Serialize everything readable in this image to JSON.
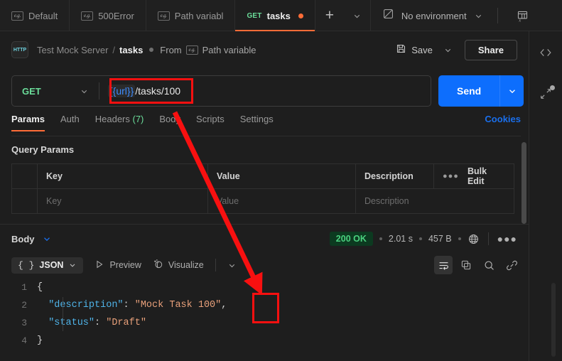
{
  "tabstrip": {
    "tabs": [
      {
        "label": "Default",
        "icon": "example-badge-icon",
        "method": "",
        "active": false,
        "unsaved": false
      },
      {
        "label": "500Error",
        "icon": "example-badge-icon",
        "method": "",
        "active": false,
        "unsaved": false
      },
      {
        "label": "Path variabl",
        "icon": "example-badge-icon",
        "method": "",
        "active": false,
        "unsaved": false
      },
      {
        "label": "tasks",
        "icon": "",
        "method": "GET",
        "active": true,
        "unsaved": true
      }
    ],
    "new_tab_label": "+",
    "tabs_caret_icon": "chevron-down-icon",
    "environment": {
      "name": "No environment",
      "caret_icon": "chevron-down-icon",
      "quicklook_icon": "environment-quicklook-icon"
    }
  },
  "rail": {
    "code_icon": "code-snippet-icon",
    "expand_icon": "expand-arrows-icon"
  },
  "breadcrumb": {
    "protocol_icon": "http-icon",
    "protocol_label": "HTTP",
    "collection": "Test Mock Server",
    "separator": "/",
    "request": "tasks",
    "from_prefix": "From",
    "from_badge_icon": "example-badge-icon",
    "from_source": "Path variable",
    "save_label": "Save",
    "save_icon": "floppy-disk-icon",
    "save_caret_icon": "chevron-down-icon",
    "share_label": "Share"
  },
  "url_bar": {
    "method": "GET",
    "method_caret_icon": "chevron-down-icon",
    "url_variable": "{{url}}",
    "url_path": " /tasks/100",
    "send_label": "Send",
    "send_caret_icon": "chevron-down-icon"
  },
  "request_tabs": {
    "items": [
      {
        "label": "Params",
        "count": "",
        "active": true
      },
      {
        "label": "Auth",
        "count": "",
        "active": false
      },
      {
        "label": "Headers",
        "count": "(7)",
        "active": false
      },
      {
        "label": "Body",
        "count": "",
        "active": false
      },
      {
        "label": "Scripts",
        "count": "",
        "active": false
      },
      {
        "label": "Settings",
        "count": "",
        "active": false
      }
    ],
    "cookies_label": "Cookies"
  },
  "query_params": {
    "section_title": "Query Params",
    "headers": [
      "",
      "Key",
      "Value",
      "Description"
    ],
    "bulk_edit_label": "Bulk Edit",
    "options_icon": "more-options-icon",
    "rows": [
      {
        "key": "Key",
        "value": "Value",
        "description": "Description"
      }
    ]
  },
  "response": {
    "body_label": "Body",
    "body_caret_icon": "chevron-down-icon",
    "status": "200 OK",
    "time": "2.01 s",
    "size": "457 B",
    "globe_icon": "globe-icon",
    "more_icon": "more-options-icon",
    "format": {
      "braces": "{ }",
      "name": "JSON",
      "caret_icon": "chevron-down-icon",
      "preview_label": "Preview",
      "preview_icon": "play-triangle-icon",
      "visualize_label": "Visualize",
      "visualize_icon": "visualize-sparkle-icon",
      "extra_caret_icon": "chevron-down-icon",
      "wrap_icon": "word-wrap-icon",
      "copy_icon": "copy-icon",
      "search_icon": "search-icon",
      "link_icon": "link-icon"
    },
    "body_lines": [
      {
        "num": "1",
        "indent": 0,
        "segments": [
          {
            "type": "brace",
            "text": "{"
          }
        ]
      },
      {
        "num": "2",
        "indent": 1,
        "segments": [
          {
            "type": "key",
            "text": "\"description\""
          },
          {
            "type": "punc",
            "text": ": "
          },
          {
            "type": "str",
            "text": "\"Mock Task 100\""
          },
          {
            "type": "punc",
            "text": ","
          }
        ]
      },
      {
        "num": "3",
        "indent": 1,
        "segments": [
          {
            "type": "key",
            "text": "\"status\""
          },
          {
            "type": "punc",
            "text": ": "
          },
          {
            "type": "str",
            "text": "\"Draft\""
          }
        ]
      },
      {
        "num": "4",
        "indent": 0,
        "segments": [
          {
            "type": "brace",
            "text": "}"
          }
        ]
      }
    ]
  },
  "annotations": {
    "color": "#f81010",
    "url_highlight_target": "{{url}} /tasks/100",
    "value_highlight_target": "100",
    "arrow_from": "url-field",
    "arrow_to": "response-100-value"
  }
}
